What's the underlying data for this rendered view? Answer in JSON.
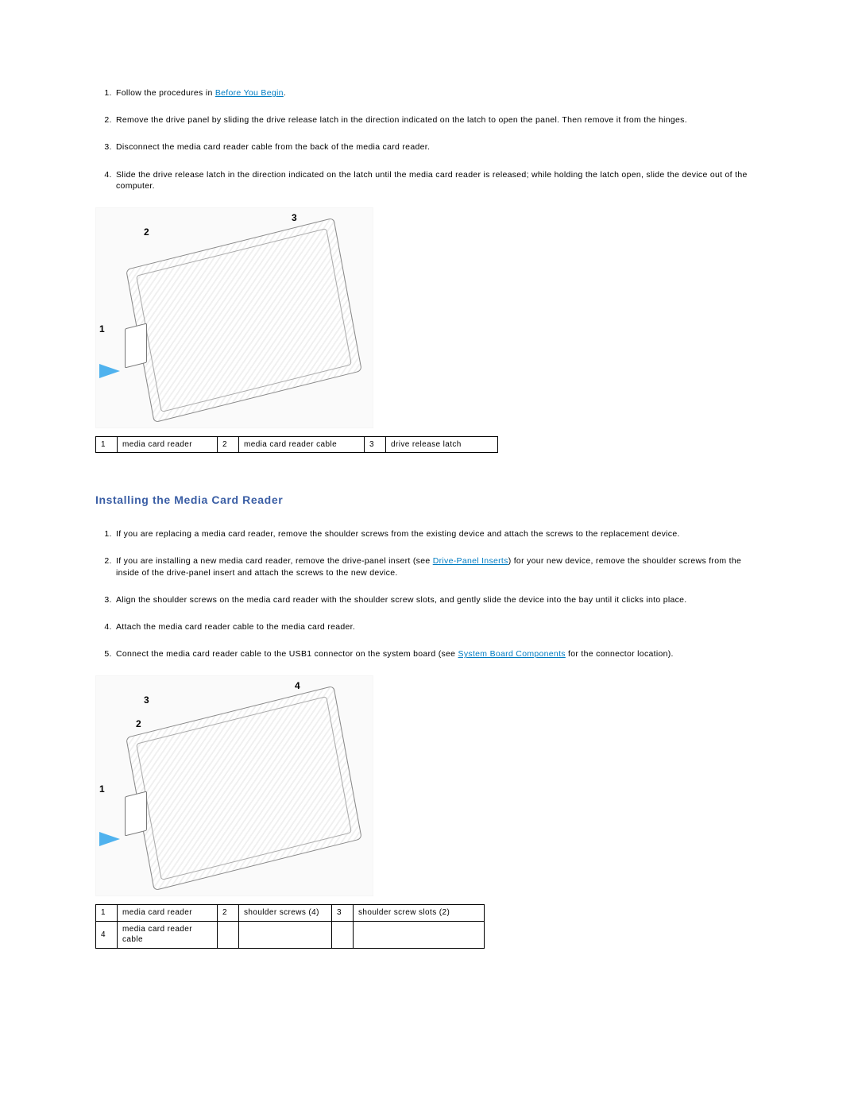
{
  "section1": {
    "steps": [
      {
        "pre": "Follow the procedures in ",
        "link": "Before You Begin",
        "post": "."
      },
      {
        "text": "Remove the drive panel by sliding the drive release latch in the direction indicated on the latch to open the panel. Then remove it from the hinges."
      },
      {
        "text": "Disconnect the media card reader cable from the back of the media card reader."
      },
      {
        "text": "Slide the drive release latch in the direction indicated on the latch until the media card reader is released; while holding the latch open, slide the device out of the computer."
      }
    ],
    "fig_callouts": {
      "c1": "1",
      "c2": "2",
      "c3": "3"
    },
    "legend": [
      {
        "n": "1",
        "t": "media card reader"
      },
      {
        "n": "2",
        "t": "media card reader cable"
      },
      {
        "n": "3",
        "t": "drive release latch"
      }
    ]
  },
  "section2": {
    "title": "Installing the Media Card Reader",
    "steps": [
      {
        "text": "If you are replacing a media card reader, remove the shoulder screws from the existing device and attach the screws to the replacement device."
      },
      {
        "pre": "If you are installing a new media card reader, remove the drive-panel insert (see ",
        "link": "Drive-Panel Inserts",
        "post": ") for your new device, remove the shoulder screws from the inside of the drive-panel insert and attach the screws to the new device."
      },
      {
        "text": "Align the shoulder screws on the media card reader with the shoulder screw slots, and gently slide the device into the bay until it clicks into place."
      },
      {
        "text": "Attach the media card reader cable to the media card reader."
      },
      {
        "pre": "Connect the media card reader cable to the USB1 connector on the system board (see ",
        "link": "System Board Components",
        "post": " for the connector location)."
      }
    ],
    "fig_callouts": {
      "c1": "1",
      "c2": "2",
      "c3": "3",
      "c4": "4"
    },
    "legend_row1": [
      {
        "n": "1",
        "t": "media card reader"
      },
      {
        "n": "2",
        "t": "shoulder screws (4)"
      },
      {
        "n": "3",
        "t": "shoulder screw slots (2)"
      }
    ],
    "legend_row2": [
      {
        "n": "4",
        "t": "media card reader cable"
      },
      {
        "n": "",
        "t": ""
      },
      {
        "n": "",
        "t": ""
      }
    ]
  }
}
